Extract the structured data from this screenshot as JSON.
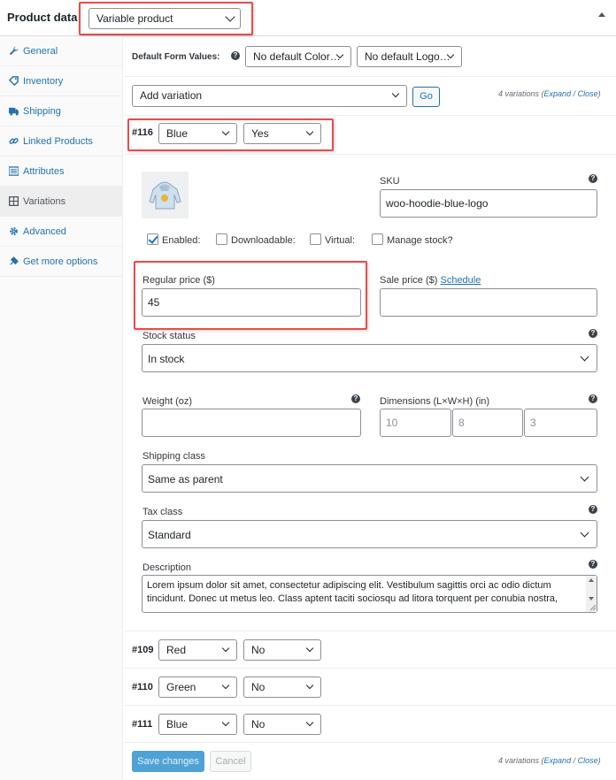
{
  "header": {
    "title": "Product data",
    "product_type": "Variable product"
  },
  "sidebar": {
    "items": [
      {
        "label": "General",
        "icon": "wrench-icon"
      },
      {
        "label": "Inventory",
        "icon": "tag-icon"
      },
      {
        "label": "Shipping",
        "icon": "truck-icon"
      },
      {
        "label": "Linked Products",
        "icon": "link-icon"
      },
      {
        "label": "Attributes",
        "icon": "list-icon"
      },
      {
        "label": "Variations",
        "icon": "grid-icon",
        "active": true
      },
      {
        "label": "Advanced",
        "icon": "gear-icon"
      },
      {
        "label": "Get more options",
        "icon": "plugin-icon"
      }
    ]
  },
  "defaults": {
    "label": "Default Form Values:",
    "color": "No default Color…",
    "logo": "No default Logo…"
  },
  "add_variation": {
    "select": "Add variation",
    "go": "Go"
  },
  "variations_note": {
    "count": "4 variations",
    "open": "(",
    "expand": "Expand",
    "sep": " / ",
    "close": "Close",
    "end": ")"
  },
  "variation_116": {
    "number": "#116",
    "color": "Blue",
    "logo": "Yes",
    "sku_label": "SKU",
    "sku": "woo-hoodie-blue-logo",
    "checkboxes": {
      "enabled": "Enabled:",
      "downloadable": "Downloadable:",
      "virtual": "Virtual:",
      "manage_stock": "Manage stock?"
    },
    "regular_price_label": "Regular price ($)",
    "regular_price": "45",
    "sale_price_label": "Sale price ($)",
    "schedule": "Schedule",
    "stock_status_label": "Stock status",
    "stock_status": "In stock",
    "weight_label": "Weight (oz)",
    "dimensions_label": "Dimensions (L×W×H) (in)",
    "length": "10",
    "width": "8",
    "height": "3",
    "shipping_class_label": "Shipping class",
    "shipping_class": "Same as parent",
    "tax_class_label": "Tax class",
    "tax_class": "Standard",
    "description_label": "Description",
    "description": "Lorem ipsum dolor sit amet, consectetur adipiscing elit. Vestibulum sagittis orci ac odio dictum tincidunt. Donec ut metus leo. Class aptent taciti sociosqu ad litora torquent per conubia nostra,"
  },
  "other_variations": [
    {
      "number": "#109",
      "color": "Red",
      "logo": "No"
    },
    {
      "number": "#110",
      "color": "Green",
      "logo": "No"
    },
    {
      "number": "#111",
      "color": "Blue",
      "logo": "No"
    }
  ],
  "footer": {
    "save": "Save changes",
    "cancel": "Cancel"
  },
  "colors": {
    "accent": "#2271b1",
    "highlight": "#e84c4c",
    "save_button": "#4fa2d6"
  }
}
